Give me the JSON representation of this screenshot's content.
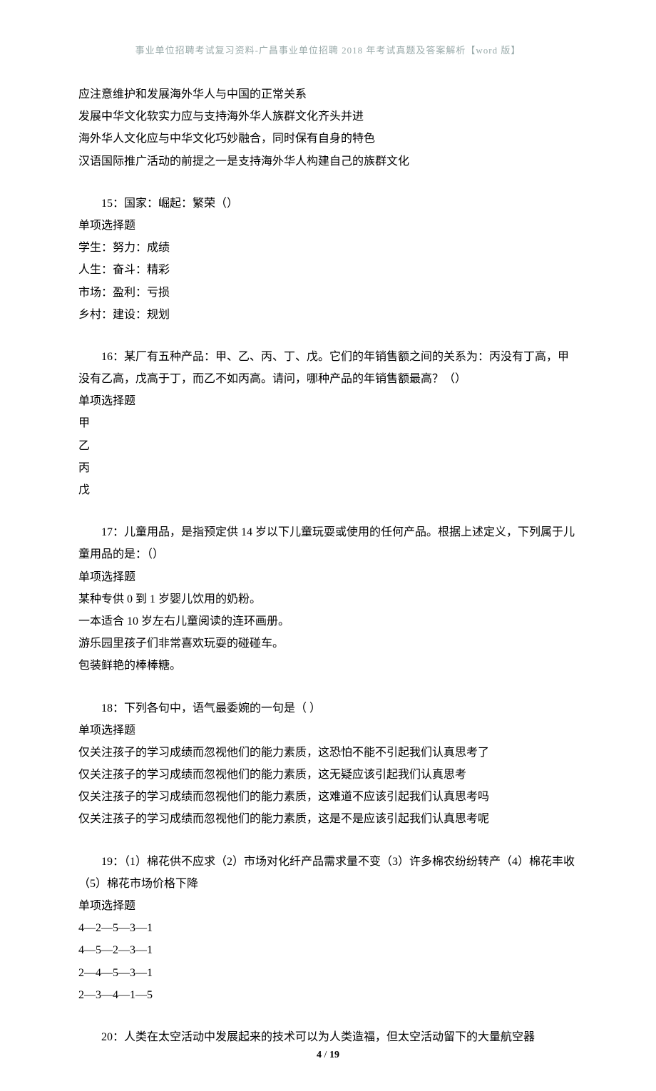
{
  "header": "事业单位招聘考试复习资料-广昌事业单位招聘 2018 年考试真题及答案解析【word 版】",
  "footer_page": "4",
  "footer_total": "19",
  "prev_options": [
    "应注意维护和发展海外华人与中国的正常关系",
    "发展中华文化软实力应与支持海外华人族群文化齐头并进",
    "海外华人文化应与中华文化巧妙融合，同时保有自身的特色",
    "汉语国际推广活动的前提之一是支持海外华人构建自己的族群文化"
  ],
  "q15": {
    "stem": "15：国家：崛起：繁荣（）",
    "type": "单项选择题",
    "options": [
      "学生：努力：成绩",
      "人生：奋斗：精彩",
      "市场：盈利：亏损",
      "乡村：建设：规划"
    ]
  },
  "q16": {
    "stem": "16：某厂有五种产品：甲、乙、丙、丁、戊。它们的年销售额之间的关系为：丙没有丁高，甲没有乙高，戊高于丁，而乙不如丙高。请问，哪种产品的年销售额最高？（）",
    "type": "单项选择题",
    "options": [
      "甲",
      "乙",
      "丙",
      "戊"
    ]
  },
  "q17": {
    "stem": "17：儿童用品，是指预定供 14 岁以下儿童玩耍或使用的任何产品。根据上述定义，下列属于儿童用品的是：（）",
    "type": "单项选择题",
    "options": [
      "某种专供 0 到 1 岁婴儿饮用的奶粉。",
      "一本适合 10 岁左右儿童阅读的连环画册。",
      "游乐园里孩子们非常喜欢玩耍的碰碰车。",
      "包装鲜艳的棒棒糖。"
    ]
  },
  "q18": {
    "stem": "18：下列各句中，语气最委婉的一句是（  ）",
    "type": "单项选择题",
    "options": [
      "仅关注孩子的学习成绩而忽视他们的能力素质，这恐怕不能不引起我们认真思考了",
      "仅关注孩子的学习成绩而忽视他们的能力素质，这无疑应该引起我们认真思考",
      "仅关注孩子的学习成绩而忽视他们的能力素质，这难道不应该引起我们认真思考吗",
      "仅关注孩子的学习成绩而忽视他们的能力素质，这是不是应该引起我们认真思考呢"
    ]
  },
  "q19": {
    "stem": "19：（1）棉花供不应求（2）市场对化纤产品需求量不变（3）许多棉农纷纷转产（4）棉花丰收（5）棉花市场价格下降",
    "type": "单项选择题",
    "options": [
      "4—2—5—3—1",
      "4—5—2—3—1",
      "2—4—5—3—1",
      "2—3—4—1—5"
    ]
  },
  "q20": {
    "stem": "20：人类在太空活动中发展起来的技术可以为人类造福，但太空活动留下的大量航空器"
  }
}
